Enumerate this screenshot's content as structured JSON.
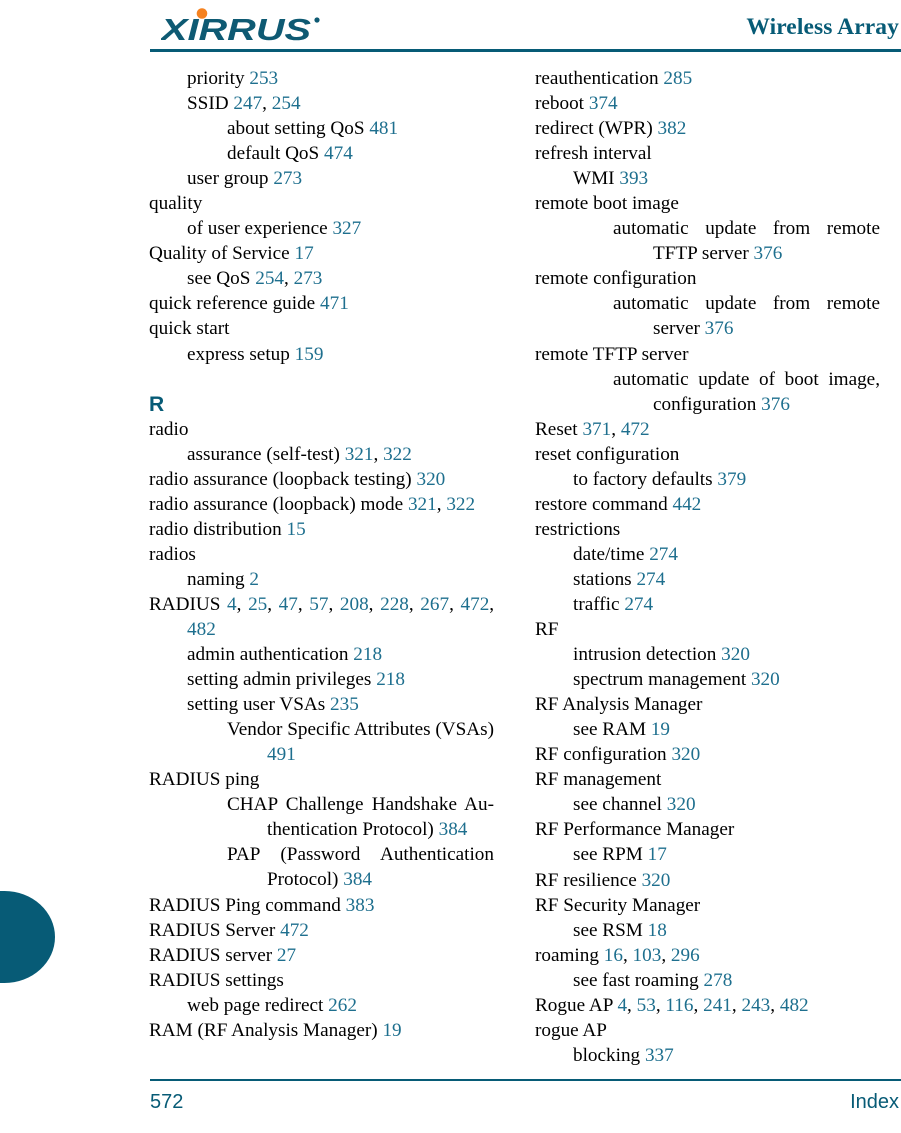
{
  "header": {
    "logo_text": "XIRRUS",
    "logo_color": "#0E5A73",
    "logo_dot_color": "#F58220",
    "title": "Wireless Array",
    "rule_color": "#075B76"
  },
  "footer": {
    "page_number": "572",
    "section_label": "Index"
  },
  "theme": {
    "accent": "#075B76",
    "page_number_link": "#1E6F8E",
    "text": "#000000"
  },
  "left_column": [
    {
      "level": 1,
      "text": "priority ",
      "pages": "253"
    },
    {
      "level": 1,
      "text": "SSID ",
      "pages": "247, 254"
    },
    {
      "level": 2,
      "text": "about setting QoS ",
      "pages": "481"
    },
    {
      "level": 2,
      "text": "default QoS ",
      "pages": "474"
    },
    {
      "level": 1,
      "text": "user group ",
      "pages": "273"
    },
    {
      "level": 0,
      "text": "quality",
      "pages": ""
    },
    {
      "level": 1,
      "text": "of user experience ",
      "pages": "327"
    },
    {
      "level": 0,
      "text": "Quality of Service ",
      "pages": "17"
    },
    {
      "level": 1,
      "text": "see QoS ",
      "pages": "254, 273"
    },
    {
      "level": 0,
      "text": "quick reference guide ",
      "pages": "471"
    },
    {
      "level": 0,
      "text": "quick start",
      "pages": ""
    },
    {
      "level": 1,
      "text": "express setup ",
      "pages": "159"
    },
    {
      "section_letter": "R"
    },
    {
      "level": 0,
      "text": "radio",
      "pages": ""
    },
    {
      "level": 1,
      "text": "assurance (self-test) ",
      "pages": "321, 322"
    },
    {
      "level": 0,
      "text": "radio assurance (loopback testing) ",
      "pages": "320"
    },
    {
      "level": 0,
      "run": 1,
      "justify": true,
      "text": "radio assurance (loopback) mode ",
      "pages": "321, 322"
    },
    {
      "level": 0,
      "text": "radio distribution ",
      "pages": "15"
    },
    {
      "level": 0,
      "text": "radios",
      "pages": ""
    },
    {
      "level": 1,
      "text": "naming ",
      "pages": "2"
    },
    {
      "level": 0,
      "run": 1,
      "justify": true,
      "text": "RADIUS ",
      "pages": "4, 25, 47, 57, 208, 228, 267, 472, 482"
    },
    {
      "level": 1,
      "text": "admin authentication ",
      "pages": "218"
    },
    {
      "level": 1,
      "text": "setting admin privileges ",
      "pages": "218"
    },
    {
      "level": 1,
      "text": "setting user VSAs ",
      "pages": "235"
    },
    {
      "level": 1,
      "run": 3,
      "justify": true,
      "text": "Vendor Specific Attributes (VSAs) ",
      "pages": "491"
    },
    {
      "level": 0,
      "text": "RADIUS ping",
      "pages": ""
    },
    {
      "level": 1,
      "run": 3,
      "justify": true,
      "text": "CHAP Challenge Handshake Au-thentication Protocol) ",
      "pages": "384"
    },
    {
      "level": 1,
      "run": 3,
      "justify": true,
      "text": "PAP (Password Authentication Protocol) ",
      "pages": "384"
    },
    {
      "level": 0,
      "text": "RADIUS Ping command ",
      "pages": "383"
    },
    {
      "level": 0,
      "text": "RADIUS Server ",
      "pages": "472"
    },
    {
      "level": 0,
      "text": "RADIUS server ",
      "pages": "27"
    },
    {
      "level": 0,
      "text": "RADIUS settings",
      "pages": ""
    },
    {
      "level": 1,
      "text": "web page redirect ",
      "pages": "262"
    },
    {
      "level": 0,
      "text": "RAM (RF Analysis Manager) ",
      "pages": "19"
    }
  ],
  "right_column": [
    {
      "level": 0,
      "text": "reauthentication ",
      "pages": "285"
    },
    {
      "level": 0,
      "text": "reboot ",
      "pages": "374"
    },
    {
      "level": 0,
      "text": "redirect (WPR) ",
      "pages": "382"
    },
    {
      "level": 0,
      "text": "refresh interval",
      "pages": ""
    },
    {
      "level": 1,
      "text": "WMI ",
      "pages": "393"
    },
    {
      "level": 0,
      "text": "remote boot image",
      "pages": ""
    },
    {
      "level": 1,
      "run": 3,
      "justify": true,
      "text": "automatic update from remote TFTP server ",
      "pages": "376"
    },
    {
      "level": 0,
      "text": "remote configuration",
      "pages": ""
    },
    {
      "level": 1,
      "run": 3,
      "justify": true,
      "text": "automatic update from remote server ",
      "pages": "376"
    },
    {
      "level": 0,
      "text": "remote TFTP server",
      "pages": ""
    },
    {
      "level": 1,
      "run": 3,
      "justify": true,
      "text": "automatic update of boot image, configuration ",
      "pages": "376"
    },
    {
      "level": 0,
      "text": "Reset ",
      "pages": "371, 472"
    },
    {
      "level": 0,
      "text": "reset configuration",
      "pages": ""
    },
    {
      "level": 1,
      "text": "to factory defaults ",
      "pages": "379"
    },
    {
      "level": 0,
      "text": "restore command ",
      "pages": "442"
    },
    {
      "level": 0,
      "text": "restrictions",
      "pages": ""
    },
    {
      "level": 1,
      "text": "date/time ",
      "pages": "274"
    },
    {
      "level": 1,
      "text": "stations ",
      "pages": "274"
    },
    {
      "level": 1,
      "text": "traffic ",
      "pages": "274"
    },
    {
      "level": 0,
      "text": "RF",
      "pages": ""
    },
    {
      "level": 1,
      "text": "intrusion detection ",
      "pages": "320"
    },
    {
      "level": 1,
      "text": "spectrum management ",
      "pages": "320"
    },
    {
      "level": 0,
      "text": "RF Analysis Manager",
      "pages": ""
    },
    {
      "level": 1,
      "text": "see RAM ",
      "pages": "19"
    },
    {
      "level": 0,
      "text": "RF configuration ",
      "pages": "320"
    },
    {
      "level": 0,
      "text": "RF management",
      "pages": ""
    },
    {
      "level": 1,
      "text": "see channel ",
      "pages": "320"
    },
    {
      "level": 0,
      "text": "RF Performance Manager",
      "pages": ""
    },
    {
      "level": 1,
      "text": "see RPM ",
      "pages": "17"
    },
    {
      "level": 0,
      "text": "RF resilience ",
      "pages": "320"
    },
    {
      "level": 0,
      "text": "RF Security Manager",
      "pages": ""
    },
    {
      "level": 1,
      "text": "see RSM ",
      "pages": "18"
    },
    {
      "level": 0,
      "text": "roaming ",
      "pages": "16, 103, 296"
    },
    {
      "level": 1,
      "text": "see fast roaming ",
      "pages": "278"
    },
    {
      "level": 0,
      "text": "Rogue AP ",
      "pages": "4, 53, 116, 241, 243, 482"
    },
    {
      "level": 0,
      "text": "rogue AP",
      "pages": ""
    },
    {
      "level": 1,
      "text": "blocking ",
      "pages": "337"
    }
  ]
}
